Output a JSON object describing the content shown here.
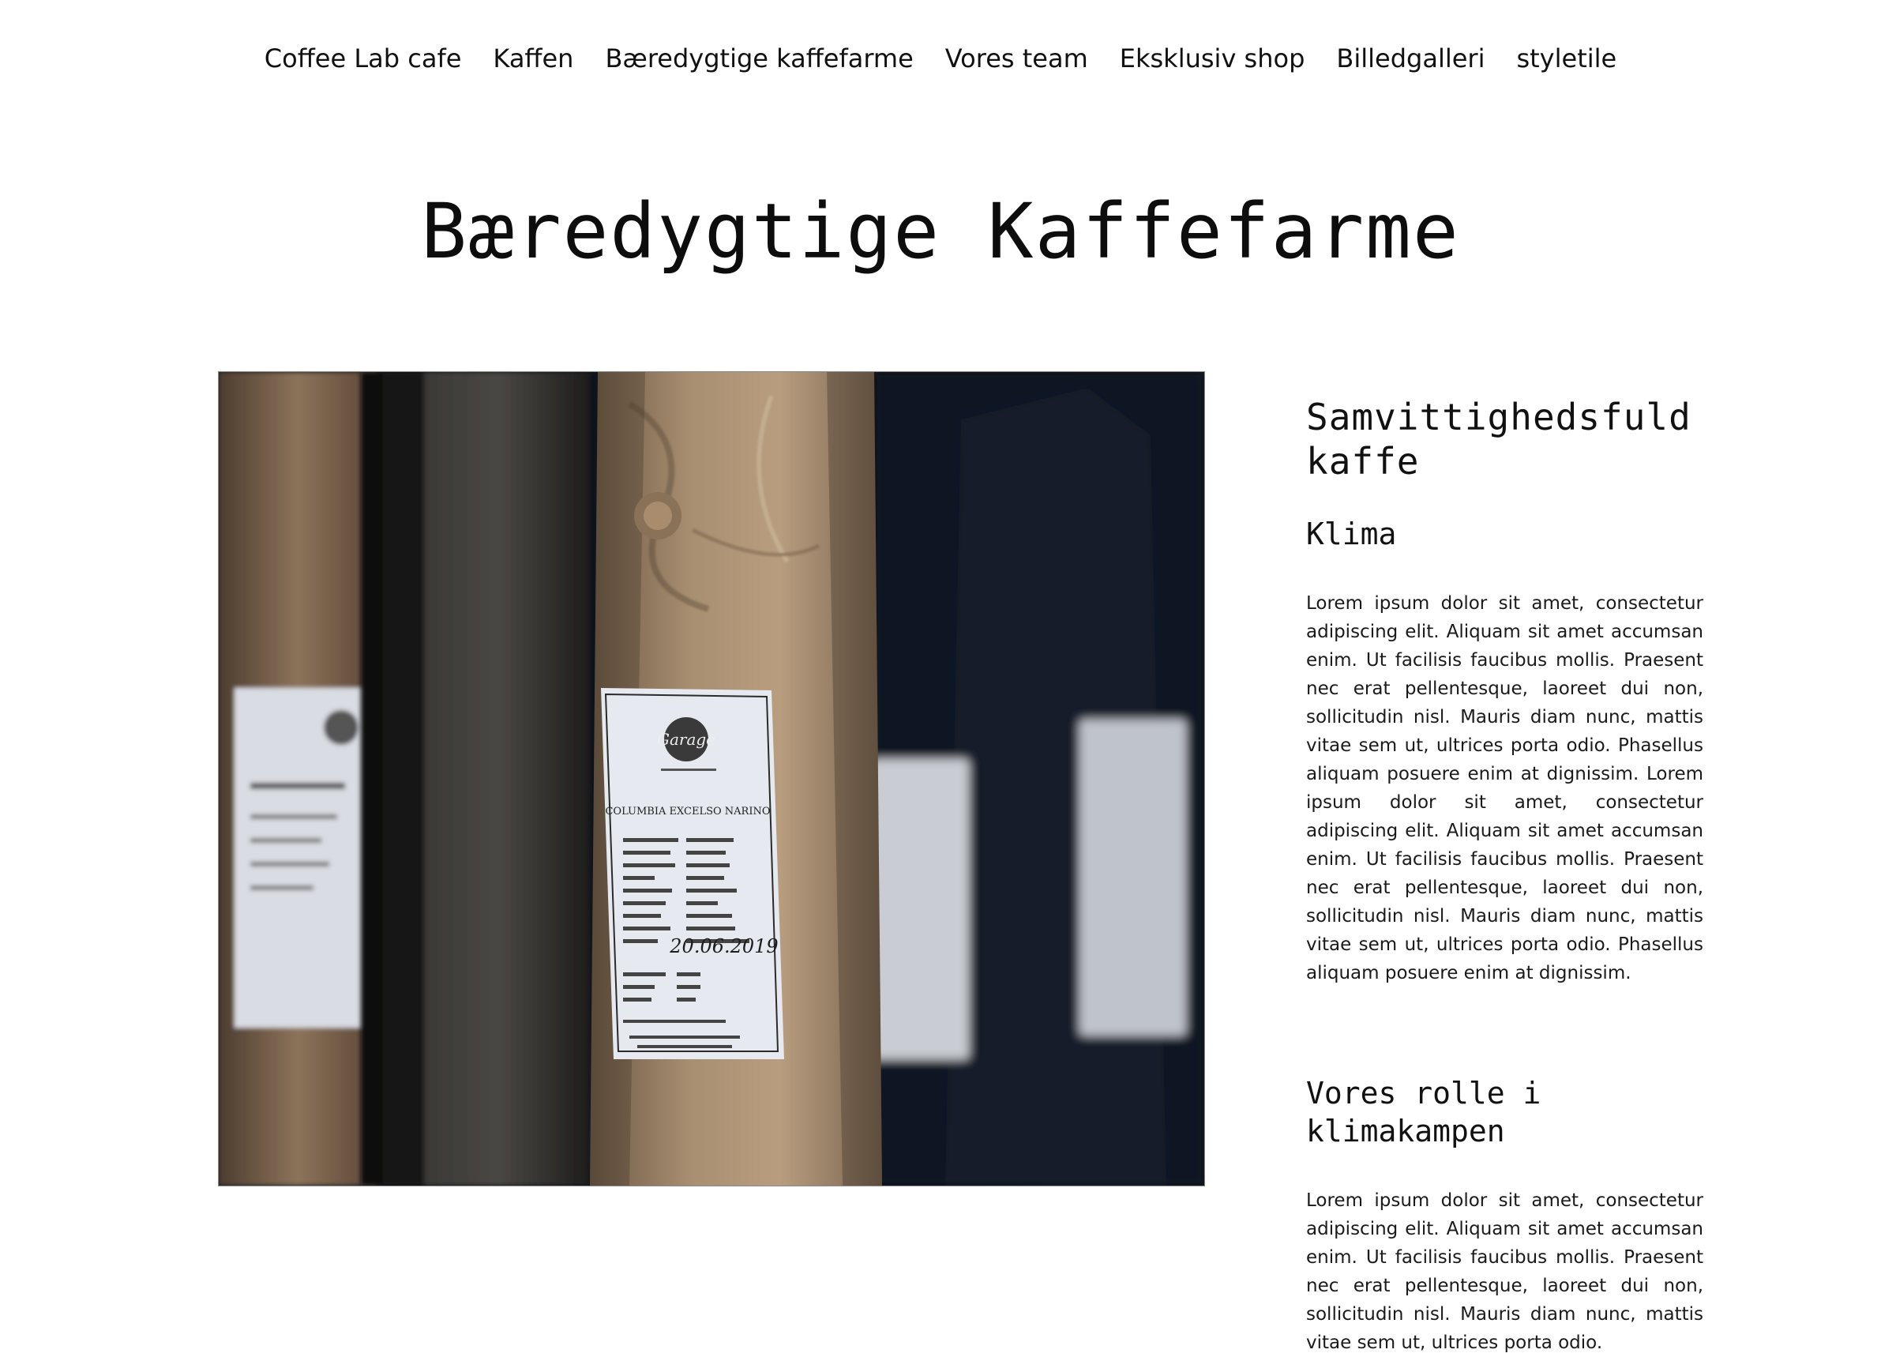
{
  "nav": {
    "items": [
      {
        "label": "Coffee Lab cafe"
      },
      {
        "label": "Kaffen"
      },
      {
        "label": "Bæredygtige kaffefarme"
      },
      {
        "label": "Vores team"
      },
      {
        "label": "Eksklusiv shop"
      },
      {
        "label": "Billedgalleri"
      },
      {
        "label": "styletile"
      }
    ]
  },
  "page": {
    "title": "Bæredygtige Kaffefarme"
  },
  "hero_image": {
    "bag_label_brand": "Garage",
    "bag_label_product": "COLUMBIA EXCELSO NARINO",
    "bag_label_date": "20.06.2019"
  },
  "aside": {
    "heading": "Samvittighedsfuld kaffe",
    "section1_title": "Klima",
    "section1_text": "Lorem ipsum dolor sit amet, consectetur adipiscing elit. Aliquam sit amet accumsan enim. Ut facilisis faucibus mollis. Praesent nec erat pellentesque, laoreet dui non, sollicitudin nisl. Mauris diam nunc, mattis vitae sem ut, ultrices porta odio. Phasellus aliquam posuere enim at dignissim. Lorem ipsum dolor sit amet, consectetur adipiscing elit. Aliquam sit amet accumsan enim. Ut facilisis faucibus mollis. Praesent nec erat pellentesque, laoreet dui non, sollicitudin nisl. Mauris diam nunc, mattis vitae sem ut, ultrices porta odio. Phasellus aliquam posuere enim at dignissim.",
    "section2_title": "Vores rolle i klimakampen",
    "section2_text": "Lorem ipsum dolor sit amet, consectetur adipiscing elit. Aliquam sit amet accumsan enim. Ut facilisis faucibus mollis. Praesent nec erat pellentesque, laoreet dui non, sollicitudin nisl. Mauris diam nunc, mattis vitae sem ut, ultrices porta odio."
  }
}
